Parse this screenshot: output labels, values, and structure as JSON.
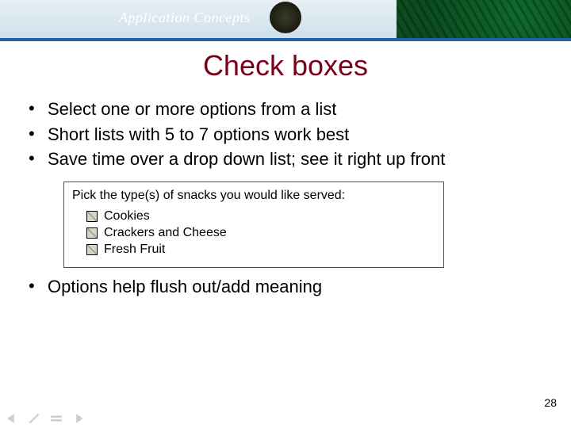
{
  "banner": {
    "text": "Application Concepts"
  },
  "title": "Check boxes",
  "bullets": [
    "Select one or more options from a list",
    "Short lists with 5 to 7 options work best",
    "Save time over a drop down list; see it right up front"
  ],
  "screenshot": {
    "prompt": "Pick the type(s) of snacks you would like served:",
    "options": [
      "Cookies",
      "Crackers and Cheese",
      "Fresh Fruit"
    ]
  },
  "bullets2": [
    "Options help flush out/add meaning"
  ],
  "page_number": "28"
}
